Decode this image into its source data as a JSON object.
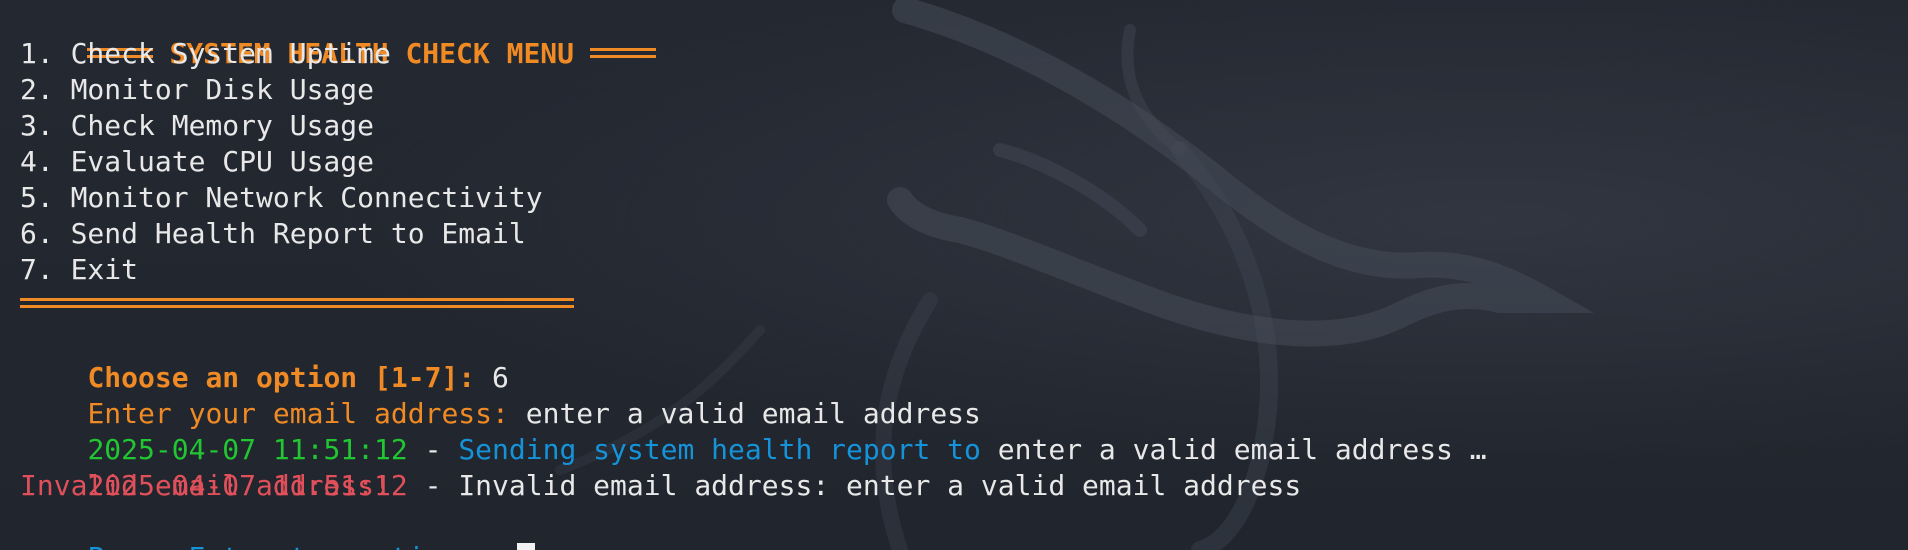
{
  "menu": {
    "title": "SYSTEM HEALTH CHECK MENU",
    "items": [
      "1. Check System Uptime",
      "2. Monitor Disk Usage",
      "3. Check Memory Usage",
      "4. Evaluate CPU Usage",
      "5. Monitor Network Connectivity",
      "6. Send Health Report to Email",
      "7. Exit"
    ]
  },
  "prompt": {
    "choose_label": "Choose an option [1-7]:",
    "choose_value": "6",
    "email_label": "Enter your email address:",
    "email_value": "enter a valid email address"
  },
  "log": [
    {
      "timestamp": "2025-04-07 11:51:12",
      "separator": " - ",
      "message": "Sending system health report to",
      "target": "enter a valid email address",
      "suffix": "…"
    },
    {
      "timestamp": "2025-04-07 11:51:12",
      "separator": " - ",
      "message": "Invalid email address: enter a valid email address"
    }
  ],
  "error_text": "Invalid email address!",
  "continue_text": "Press Enter to continue",
  "continue_suffix": "…",
  "colors": {
    "background": "#23272f",
    "orange": "#f08a24",
    "green": "#22c532",
    "blue": "#1593d8",
    "red": "#e0505a",
    "text": "#e6e6e6"
  },
  "icons": [
    "dragon-background-icon",
    "cursor-block-icon"
  ]
}
